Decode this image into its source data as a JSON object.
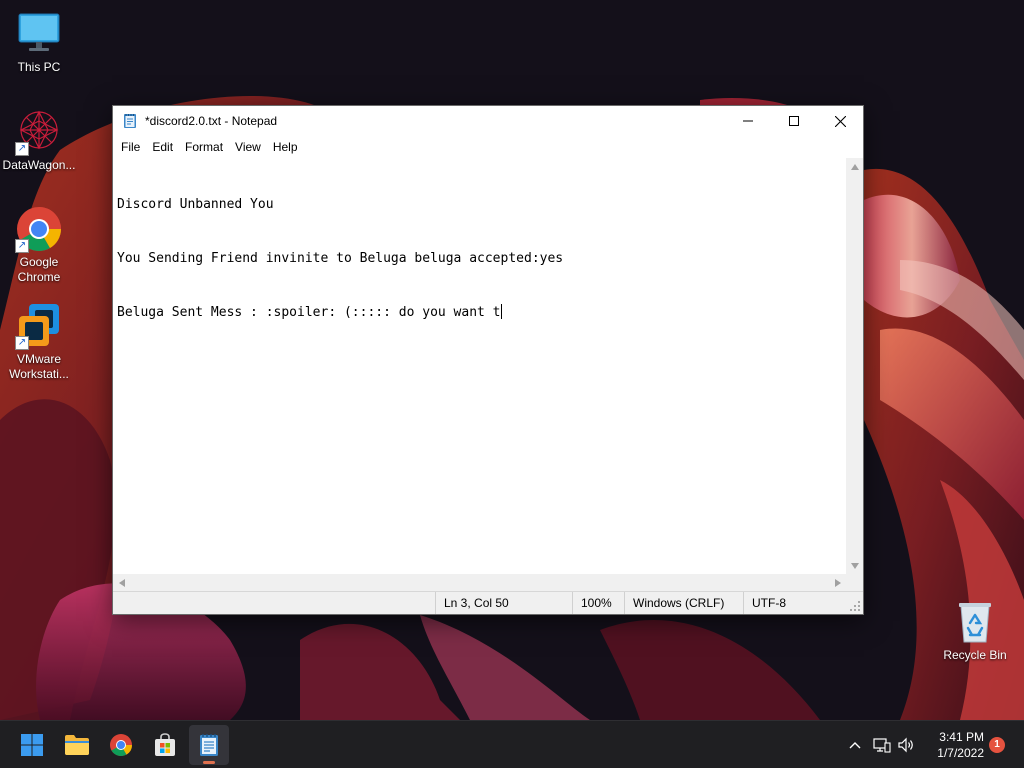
{
  "desktop": {
    "icons": [
      {
        "label": "This PC",
        "icon": "monitor-icon"
      },
      {
        "label": "DataWagon...",
        "icon": "datawagon-icon"
      },
      {
        "label": "Google Chrome",
        "icon": "chrome-icon"
      },
      {
        "label": "VMware Workstati...",
        "icon": "vmware-icon"
      },
      {
        "label": "Recycle Bin",
        "icon": "recycle-bin-icon"
      }
    ]
  },
  "window": {
    "title": "*discord2.0.txt - Notepad",
    "menu": [
      "File",
      "Edit",
      "Format",
      "View",
      "Help"
    ],
    "content_lines": [
      "Discord Unbanned You",
      "You Sending Friend invinite to Beluga beluga accepted:yes",
      "Beluga Sent Mess : :spoiler: (::::: do you want t"
    ],
    "status": {
      "position": "Ln 3, Col 50",
      "zoom": "100%",
      "line_ending": "Windows (CRLF)",
      "encoding": "UTF-8"
    }
  },
  "taskbar": {
    "apps": [
      "start-icon",
      "file-explorer-icon",
      "chrome-icon",
      "microsoft-store-icon",
      "notepad-icon"
    ],
    "active_app": "notepad-icon",
    "clock_time": "3:41 PM",
    "clock_date": "1/7/2022",
    "notification_count": "1"
  },
  "colors": {
    "accent": "#e0714f",
    "taskbar_bg": "#1f1f22",
    "notification_badge": "#e5523f"
  }
}
